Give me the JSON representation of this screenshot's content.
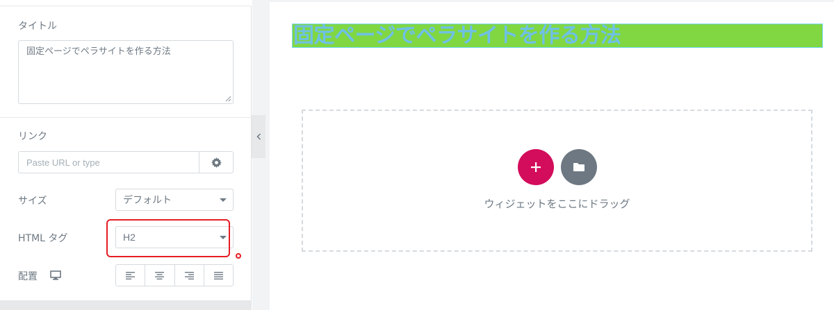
{
  "panel": {
    "title_label": "タイトル",
    "title_value": "固定ページでペラサイトを作る方法",
    "link_label": "リンク",
    "link_placeholder": "Paste URL or type",
    "size_label": "サイズ",
    "size_value": "デフォルト",
    "html_tag_label": "HTML タグ",
    "html_tag_value": "H2",
    "align_label": "配置",
    "align_options": [
      "left",
      "center",
      "right",
      "justify"
    ]
  },
  "canvas": {
    "heading_text": "固定ページでペラサイトを作る方法",
    "drop_text": "ウィジェットをここにドラッグ"
  },
  "colors": {
    "accent_pink": "#d30c5c",
    "heading_bg": "#81d742",
    "heading_text": "#6ec1e4",
    "highlight_red": "#e51c23"
  },
  "icons": {
    "link_options": "gear-icon",
    "responsive": "desktop-icon",
    "add": "plus-icon",
    "template": "folder-icon",
    "collapse": "chevron-left-icon"
  }
}
